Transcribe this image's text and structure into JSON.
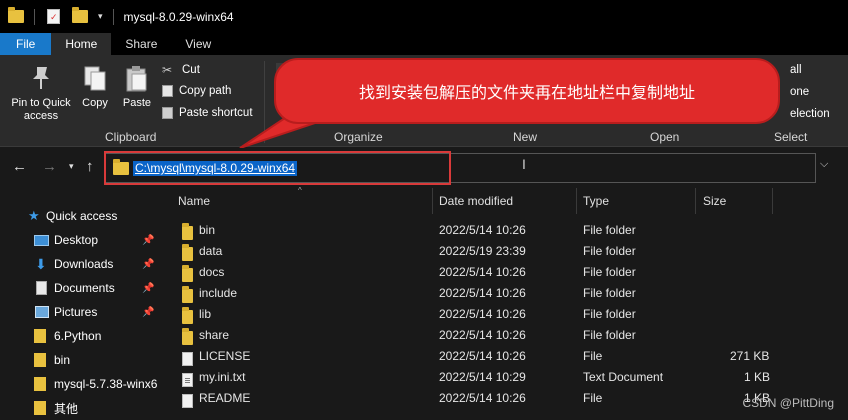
{
  "window": {
    "title": "mysql-8.0.29-winx64"
  },
  "ribbon_tabs": [
    "File",
    "Home",
    "Share",
    "View"
  ],
  "ribbon": {
    "clipboard": {
      "pin_label_1": "Pin to Quick",
      "pin_label_2": "access",
      "copy_label": "Copy",
      "paste_label": "Paste",
      "cut_label": "Cut",
      "copy_path_label": "Copy path",
      "paste_shortcut_label": "Paste shortcut",
      "group_label": "Clipboard"
    },
    "organize_label": "Organize",
    "new_label": "New",
    "open_label": "Open",
    "select": {
      "select_all_fragment": "all",
      "select_none_fragment": "one",
      "invert_selection_fragment": "election",
      "group_label": "Select"
    }
  },
  "address_bar": {
    "path": "C:\\mysql\\mysql-8.0.29-winx64"
  },
  "callout": {
    "text": "找到安装包解压的文件夹再在地址栏中复制地址"
  },
  "nav_pane": {
    "items": [
      {
        "label": "Quick access",
        "icon": "star-icon",
        "pinned": false
      },
      {
        "label": "Desktop",
        "icon": "desktop-icon",
        "pinned": true
      },
      {
        "label": "Downloads",
        "icon": "download-icon",
        "pinned": true
      },
      {
        "label": "Documents",
        "icon": "document-icon",
        "pinned": true
      },
      {
        "label": "Pictures",
        "icon": "pictures-icon",
        "pinned": true
      },
      {
        "label": "6.Python",
        "icon": "folder-icon",
        "pinned": false
      },
      {
        "label": "bin",
        "icon": "folder-icon",
        "pinned": false
      },
      {
        "label": "mysql-5.7.38-winx6",
        "icon": "folder-icon",
        "pinned": false
      },
      {
        "label": "其他",
        "icon": "folder-icon",
        "pinned": false
      }
    ]
  },
  "file_list": {
    "columns": [
      "Name",
      "Date modified",
      "Type",
      "Size"
    ],
    "rows": [
      {
        "name": "bin",
        "date": "2022/5/14 10:26",
        "type": "File folder",
        "size": "",
        "icon": "folder-icon"
      },
      {
        "name": "data",
        "date": "2022/5/19 23:39",
        "type": "File folder",
        "size": "",
        "icon": "folder-icon"
      },
      {
        "name": "docs",
        "date": "2022/5/14 10:26",
        "type": "File folder",
        "size": "",
        "icon": "folder-icon"
      },
      {
        "name": "include",
        "date": "2022/5/14 10:26",
        "type": "File folder",
        "size": "",
        "icon": "folder-icon"
      },
      {
        "name": "lib",
        "date": "2022/5/14 10:26",
        "type": "File folder",
        "size": "",
        "icon": "folder-icon"
      },
      {
        "name": "share",
        "date": "2022/5/14 10:26",
        "type": "File folder",
        "size": "",
        "icon": "folder-icon"
      },
      {
        "name": "LICENSE",
        "date": "2022/5/14 10:26",
        "type": "File",
        "size": "271 KB",
        "icon": "file-icon"
      },
      {
        "name": "my.ini.txt",
        "date": "2022/5/14 10:29",
        "type": "Text Document",
        "size": "1 KB",
        "icon": "text-file-icon"
      },
      {
        "name": "README",
        "date": "2022/5/14 10:26",
        "type": "File",
        "size": "1 KB",
        "icon": "file-icon"
      }
    ]
  },
  "watermark": "CSDN @PittDing",
  "colors": {
    "file_tab": "#1979ca",
    "selection": "#0a64c8",
    "callout": "#e02a2a",
    "highlight_box": "#d93a3a",
    "folder": "#e8c13f"
  }
}
